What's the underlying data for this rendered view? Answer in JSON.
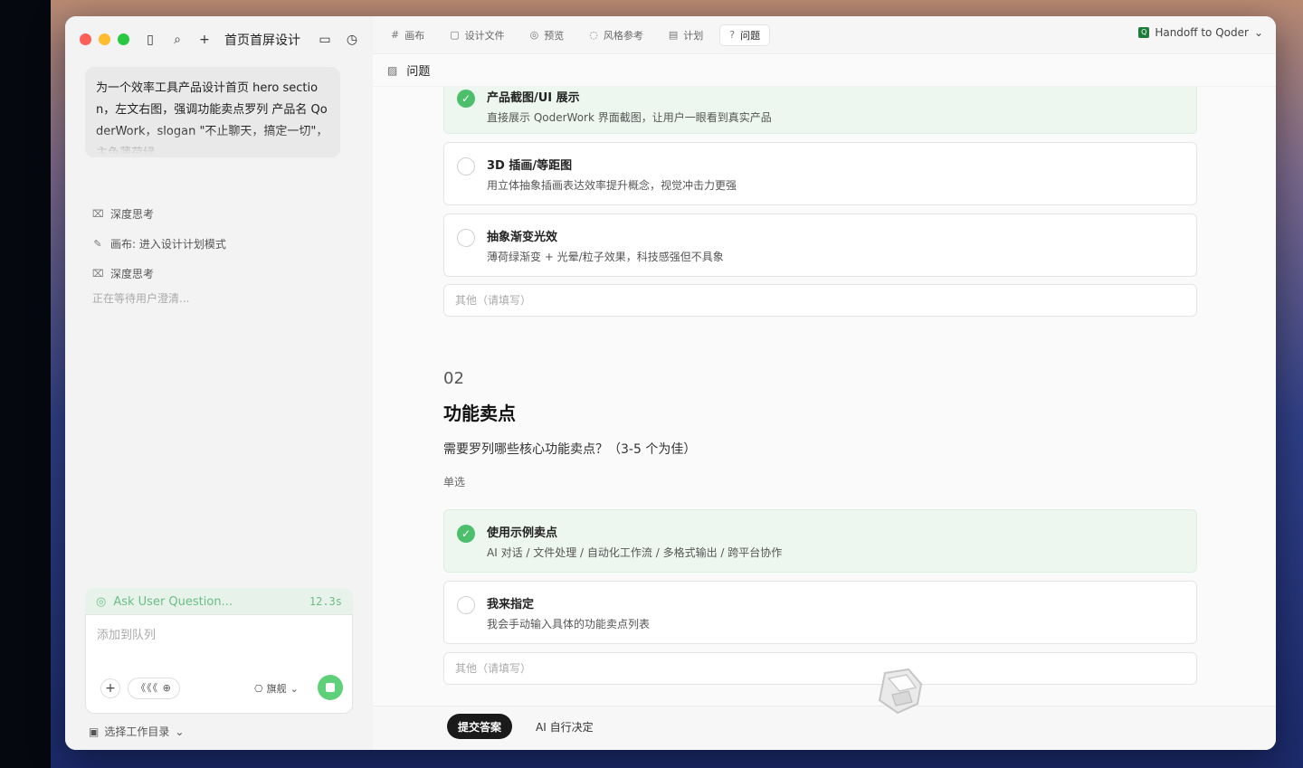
{
  "sidebar": {
    "title": "首页首屏设计",
    "prompt": "为一个效率工具产品设计首页 hero section，左文右图，强调功能卖点罗列 产品名 QoderWork，slogan \"不止聊天，搞定一切\"，主色薄荷绿",
    "steps": [
      {
        "icon": "thinking-icon",
        "label": "深度思考"
      },
      {
        "icon": "brush-icon",
        "label": "画布: 进入设计计划模式"
      },
      {
        "icon": "thinking-icon",
        "label": "深度思考"
      }
    ],
    "waiting": "正在等待用户澄清...",
    "status": {
      "label": "Ask User Question...",
      "time": "12.3s"
    },
    "composer": {
      "placeholder": "添加到队列",
      "pill": "《《《 ⊕",
      "model": "旗舰"
    },
    "workdir": "选择工作目录"
  },
  "tabs": [
    {
      "icon": "#",
      "label": "画布"
    },
    {
      "icon": "▢",
      "label": "设计文件"
    },
    {
      "icon": "◎",
      "label": "预览"
    },
    {
      "icon": "◌",
      "label": "风格参考"
    },
    {
      "icon": "▤",
      "label": "计划"
    },
    {
      "icon": "?",
      "label": "问题"
    }
  ],
  "handoff": "Handoff to Qoder",
  "panel_title": "问题",
  "q1": {
    "options": [
      {
        "title": "产品截图/UI 展示",
        "desc": "直接展示 QoderWork 界面截图，让用户一眼看到真实产品",
        "selected": true
      },
      {
        "title": "3D 插画/等距图",
        "desc": "用立体抽象插画表达效率提升概念，视觉冲击力更强",
        "selected": false
      },
      {
        "title": "抽象渐变光效",
        "desc": "薄荷绿渐变 + 光晕/粒子效果，科技感强但不具象",
        "selected": false
      }
    ],
    "other_placeholder": "其他（请填写）"
  },
  "q2": {
    "number": "02",
    "title": "功能卖点",
    "question": "需要罗列哪些核心功能卖点？（3-5 个为佳）",
    "mode": "单选",
    "options": [
      {
        "title": "使用示例卖点",
        "desc": "AI 对话 / 文件处理 / 自动化工作流 / 多格式输出 / 跨平台协作",
        "selected": true
      },
      {
        "title": "我来指定",
        "desc": "我会手动输入具体的功能卖点列表",
        "selected": false
      }
    ],
    "other_placeholder": "其他（请填写）"
  },
  "footer": {
    "submit": "提交答案",
    "ai_decide": "AI 自行决定"
  },
  "colors": {
    "accent": "#4cbe6c",
    "selected_bg": "#edf7ef"
  }
}
